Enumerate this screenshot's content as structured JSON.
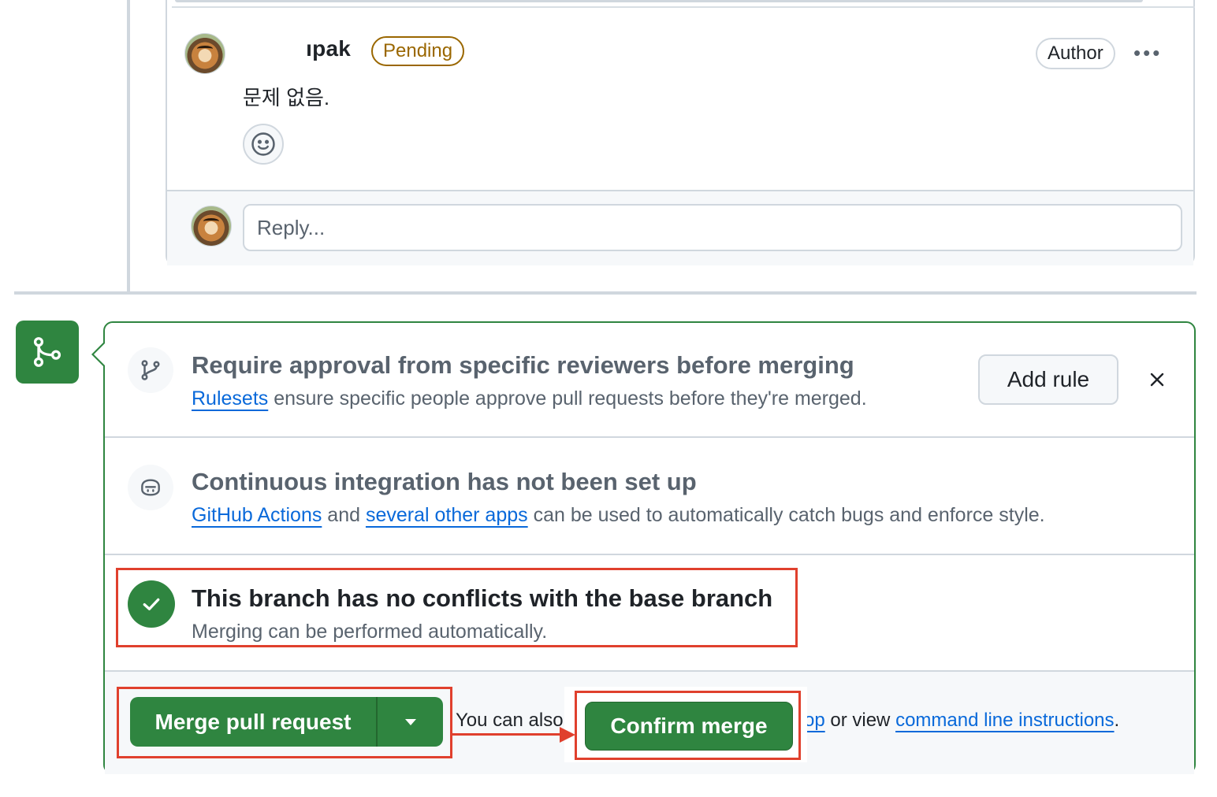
{
  "comment": {
    "username_visible": "ıpak",
    "status_badge": "Pending",
    "role_badge": "Author",
    "more_label": "•••",
    "body": "문제 없음.",
    "reply_placeholder": "Reply..."
  },
  "merge_box": {
    "approval": {
      "title": "Require approval from specific reviewers before merging",
      "link_text": "Rulesets",
      "desc_rest": " ensure specific people approve pull requests before they're merged.",
      "add_rule_label": "Add rule"
    },
    "ci": {
      "title": "Continuous integration has not been set up",
      "link1": "GitHub Actions",
      "and_text": " and ",
      "link2": "several other apps",
      "desc_rest": " can be used to automatically catch bugs and enforce style."
    },
    "conflicts": {
      "title": "This branch has no conflicts with the base branch",
      "desc": "Merging can be performed automatically."
    },
    "footer": {
      "merge_button": "Merge pull request",
      "you_can_also": "You can also",
      "partial_link": "op",
      "or_view": " or view ",
      "cli_link": "command line instructions",
      "period": ".",
      "confirm_button": "Confirm merge"
    }
  },
  "colors": {
    "success_green": "#2f8540",
    "link_blue": "#0969da",
    "pending_amber": "#9a6700",
    "annotation_red": "#e0402d"
  }
}
